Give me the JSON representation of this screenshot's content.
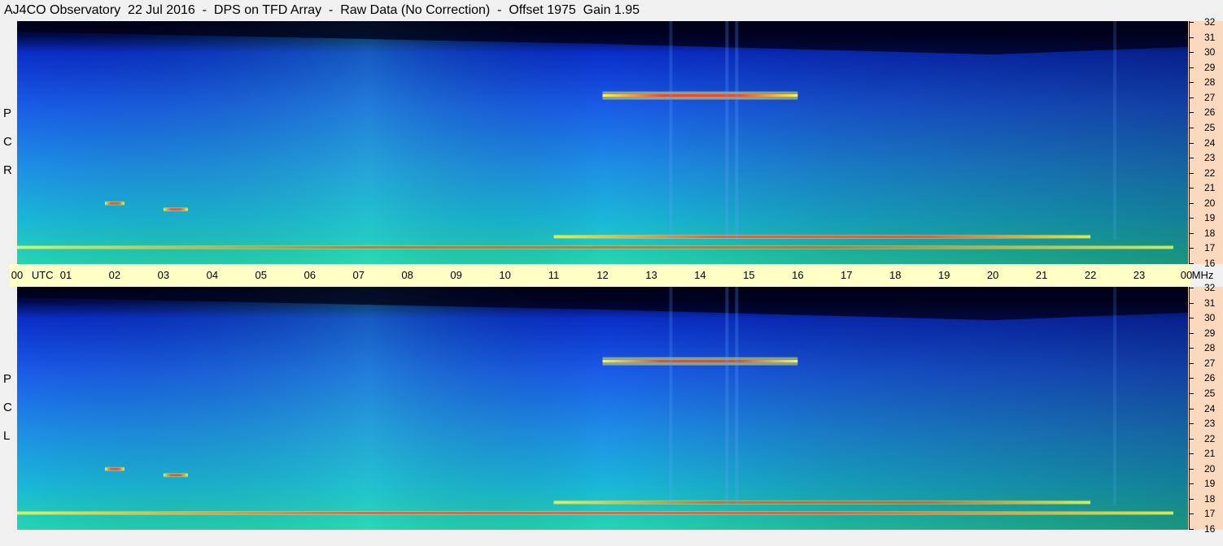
{
  "title": "AJ4CO Observatory  22 Jul 2016  -  DPS on TFD Array  -  Raw Data (No Correction)  -  Offset 1975  Gain 1.95",
  "colors": {
    "title_bar_bg": "#f0f0f0",
    "utc_band": "#ffffc6",
    "freq_axis_bg": "#fbd9bf"
  },
  "panels": [
    {
      "id": "rcp",
      "label": [
        "R",
        "C",
        "P"
      ]
    },
    {
      "id": "lcp",
      "label": [
        "L",
        "C",
        "P"
      ]
    }
  ],
  "time_axis": {
    "ticks": [
      "00",
      "01",
      "02",
      "03",
      "04",
      "05",
      "06",
      "07",
      "08",
      "09",
      "10",
      "11",
      "12",
      "13",
      "14",
      "15",
      "16",
      "17",
      "18",
      "19",
      "20",
      "21",
      "22",
      "23",
      "00"
    ],
    "unit_label": "UTC",
    "end_unit": "MHz"
  },
  "freq_axis": {
    "ticks": [
      16,
      17,
      18,
      19,
      20,
      21,
      22,
      23,
      24,
      25,
      26,
      27,
      28,
      29,
      30,
      31,
      32
    ]
  },
  "chart_data": {
    "type": "heatmap",
    "title": "AJ4CO Observatory  22 Jul 2016  -  DPS on TFD Array  -  Raw Data (No Correction)  -  Offset 1975  Gain 1.95",
    "x_label": "UTC",
    "y_label": "MHz",
    "xlim": [
      0,
      24
    ],
    "ylim": [
      16,
      32
    ],
    "panels": [
      "RCP",
      "LCP"
    ],
    "features": [
      {
        "kind": "band",
        "start_utc": 12.0,
        "end_utc": 16.0,
        "freq_mhz": 27.1,
        "intensity": 0.95
      },
      {
        "kind": "band",
        "start_utc": 11.0,
        "end_utc": 22.0,
        "freq_mhz": 17.8,
        "intensity": 0.75
      },
      {
        "kind": "band",
        "start_utc": 0.0,
        "end_utc": 23.7,
        "freq_mhz": 17.1,
        "intensity": 0.7
      },
      {
        "kind": "band",
        "start_utc": 1.8,
        "end_utc": 2.2,
        "freq_mhz": 20.0,
        "intensity": 0.8
      },
      {
        "kind": "band",
        "start_utc": 3.0,
        "end_utc": 3.5,
        "freq_mhz": 19.6,
        "intensity": 0.8
      },
      {
        "kind": "spike",
        "utc": 13.4,
        "intensity": 0.6
      },
      {
        "kind": "spike",
        "utc": 14.55,
        "intensity": 0.7
      },
      {
        "kind": "spike",
        "utc": 14.75,
        "intensity": 0.7
      },
      {
        "kind": "spike",
        "utc": 22.5,
        "intensity": 0.5
      }
    ]
  }
}
